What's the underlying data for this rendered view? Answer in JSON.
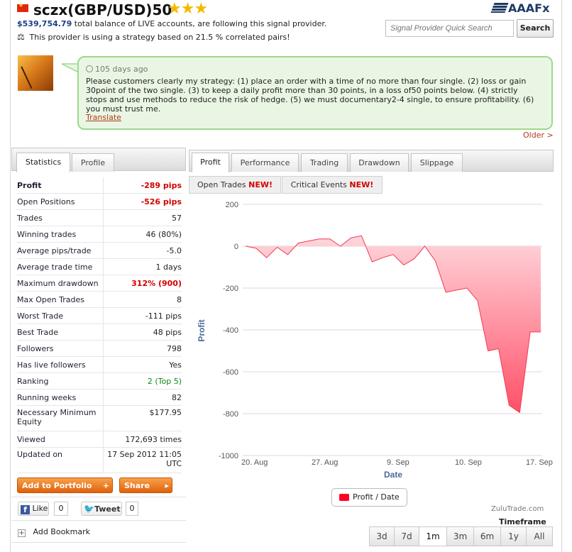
{
  "provider": {
    "name": "sczx(GBP/USD)50",
    "stars": "★★★",
    "balance_amount": "$539,754.79",
    "balance_text": "total balance of LIVE accounts, are following this signal provider.",
    "strategy_text": "This provider is using a strategy based on 21.5 % correlated pairs!"
  },
  "brand": {
    "logo_text": "AAAFx"
  },
  "search": {
    "placeholder": "Signal Provider Quick Search",
    "button_label": "Search"
  },
  "message": {
    "time": "105 days ago",
    "text": "Please customers clearly my strategy: (1) place an order with a time of no more than four single. (2) loss or gain 30point of the two single. (3) to keep a daily profit more than 30 points, in a loss of50 points below. (4) strictly stops and use methods to reduce the risk of hedge. (5) we must documentary2-4 single, to ensure profitability. (6) you must trust me.",
    "translate_label": "Translate",
    "older_label": "Older >"
  },
  "left_tabs": [
    "Statistics",
    "Profile"
  ],
  "stats": [
    {
      "label": "Profit",
      "value": "-289 pips"
    },
    {
      "label": "Open Positions",
      "value": "-526 pips"
    },
    {
      "label": "Trades",
      "value": "57"
    },
    {
      "label": "Winning trades",
      "value": "46 (80%)"
    },
    {
      "label": "Average pips/trade",
      "value": "-5.0"
    },
    {
      "label": "Average trade time",
      "value": "1 days"
    },
    {
      "label": "Maximum drawdown",
      "value": "312% (900)"
    },
    {
      "label": "Max Open Trades",
      "value": "8"
    },
    {
      "label": "Worst Trade",
      "value": "-111 pips"
    },
    {
      "label": "Best Trade",
      "value": "48 pips"
    },
    {
      "label": "Followers",
      "value": "798"
    },
    {
      "label": "Has live followers",
      "value": "Yes"
    },
    {
      "label": "Ranking",
      "value": "2 (Top 5)"
    },
    {
      "label": "Running weeks",
      "value": "82"
    },
    {
      "label": "Necessary Minimum Equity",
      "value": "$177.95"
    },
    {
      "label": "Viewed",
      "value": "172,693 times"
    },
    {
      "label": "Updated on",
      "value": "17 Sep 2012 11:05 UTC"
    }
  ],
  "actions": {
    "add_portfolio": "Add to Portfolio",
    "share": "Share",
    "like": "Like",
    "like_count": "0",
    "tweet": "Tweet",
    "tweet_count": "0",
    "bookmark": "Add Bookmark"
  },
  "right_tabs": [
    "Profit",
    "Performance",
    "Trading",
    "Drawdown",
    "Slippage"
  ],
  "sub_tabs": [
    {
      "label": "Open Trades",
      "badge": "NEW!"
    },
    {
      "label": "Critical Events",
      "badge": "NEW!"
    }
  ],
  "chart_data": {
    "type": "area",
    "xlabel": "Date",
    "ylabel": "Profit",
    "ylim": [
      -1000,
      200
    ],
    "yticks": [
      200,
      0,
      -200,
      -400,
      -600,
      -800,
      -1000
    ],
    "xticks": [
      "20. Aug",
      "27. Aug",
      "9. Sep",
      "10. Sep",
      "17. Sep"
    ],
    "series": [
      {
        "name": "Profit / Date",
        "values": [
          0,
          -10,
          -55,
          -5,
          -40,
          15,
          25,
          35,
          35,
          0,
          40,
          50,
          -75,
          -55,
          -40,
          -90,
          -60,
          0,
          -70,
          -220,
          -210,
          -200,
          -260,
          -500,
          -490,
          -760,
          -795,
          -410,
          -410
        ]
      }
    ],
    "legend_position": "bottom-center",
    "grid": true,
    "color": "#ff0022"
  },
  "chart_credit": "ZuluTrade.com",
  "timeframe": {
    "label": "Timeframe",
    "options": [
      "3d",
      "7d",
      "1m",
      "3m",
      "6m",
      "1y",
      "All"
    ],
    "selected": "1m"
  }
}
